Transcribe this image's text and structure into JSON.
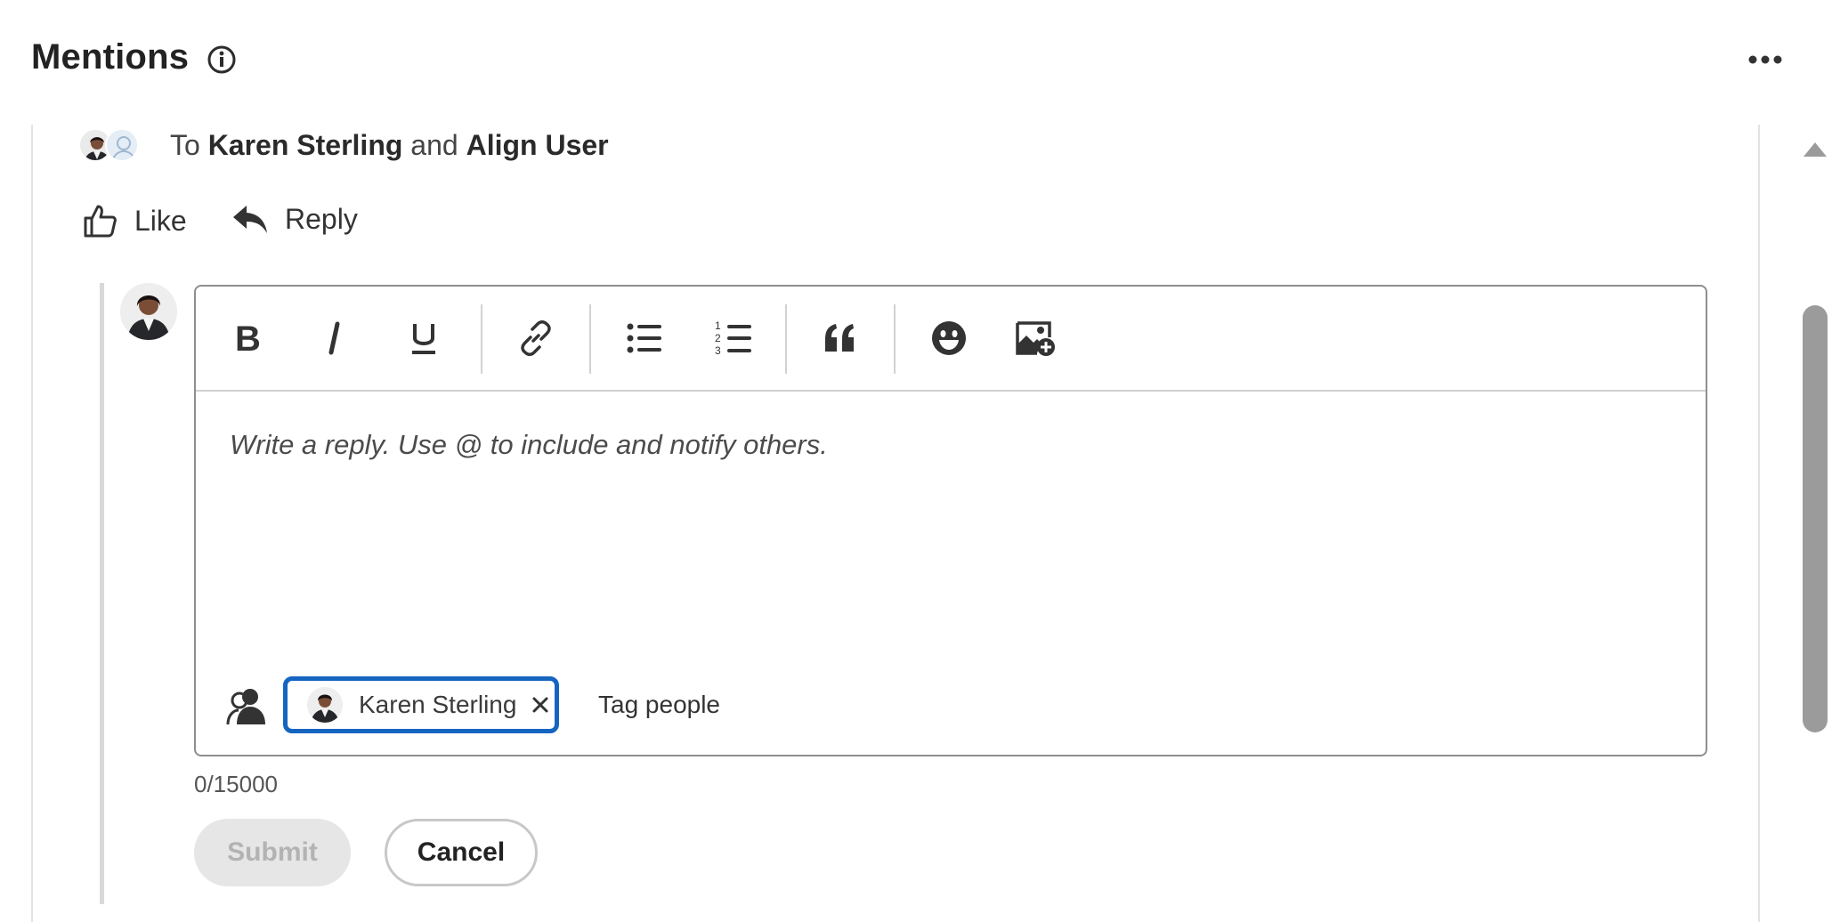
{
  "header": {
    "title": "Mentions",
    "info_icon": "info-icon",
    "more_icon": "more-horizontal-icon"
  },
  "comment": {
    "to_prefix": "To",
    "recipient_1": "Karen Sterling",
    "conjunction": "and",
    "recipient_2": "Align User"
  },
  "actions": {
    "like_label": "Like",
    "reply_label": "Reply"
  },
  "editor": {
    "toolbar": [
      {
        "name": "bold-button",
        "icon": "bold-icon"
      },
      {
        "name": "italic-button",
        "icon": "italic-icon"
      },
      {
        "name": "underline-button",
        "icon": "underline-icon"
      },
      {
        "name": "link-button",
        "icon": "link-icon"
      },
      {
        "name": "bullet-list-button",
        "icon": "bullet-list-icon"
      },
      {
        "name": "numbered-list-button",
        "icon": "numbered-list-icon"
      },
      {
        "name": "quote-button",
        "icon": "quote-icon"
      },
      {
        "name": "emoji-button",
        "icon": "emoji-icon"
      },
      {
        "name": "insert-image-button",
        "icon": "image-add-icon"
      }
    ],
    "placeholder": "Write a reply. Use @ to include and notify others.",
    "tagged_person": "Karen Sterling",
    "tag_placeholder": "Tag people",
    "char_count": "0/15000"
  },
  "buttons": {
    "submit_label": "Submit",
    "cancel_label": "Cancel"
  },
  "colors": {
    "focus_ring": "#1565c0",
    "disabled_bg": "#e6e6e6",
    "scroll_thumb": "#9b9b9b"
  }
}
